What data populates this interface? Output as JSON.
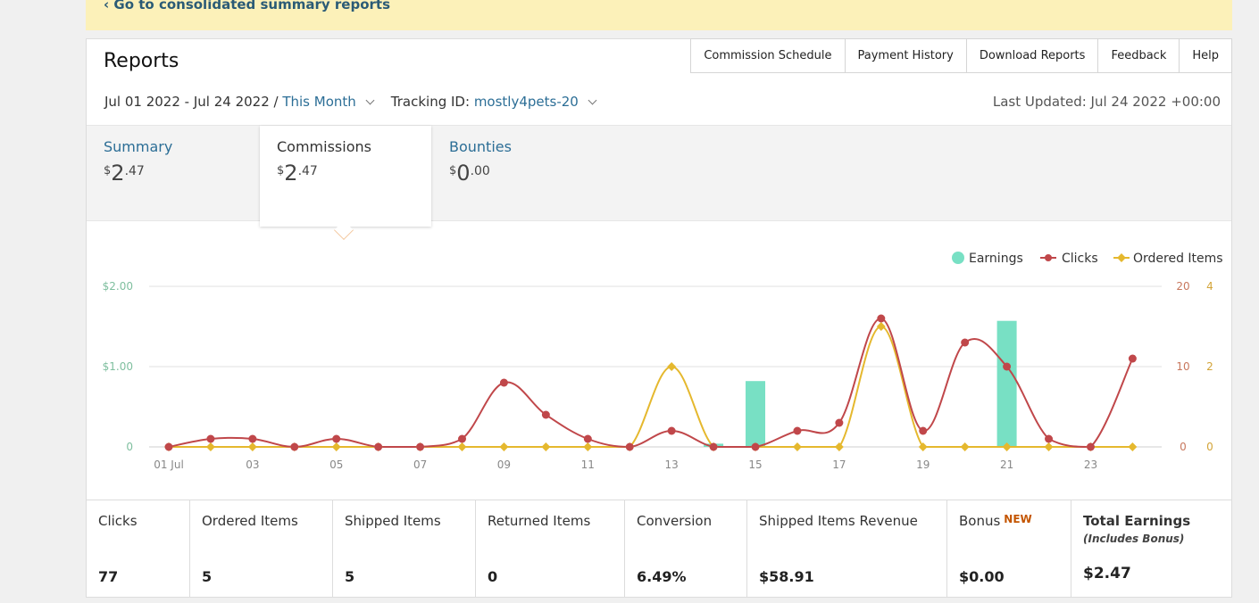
{
  "notice": {
    "link": "‹ Go to consolidated summary reports"
  },
  "header": {
    "title": "Reports"
  },
  "top_tabs": [
    "Commission Schedule",
    "Payment History",
    "Download Reports",
    "Feedback",
    "Help"
  ],
  "filters": {
    "date_range": "Jul 01 2022 - Jul 24 2022 /",
    "period": "This Month",
    "tracking_label": "Tracking ID:",
    "tracking_id": "mostly4pets-20",
    "last_updated": "Last Updated: Jul 24 2022 +00:00"
  },
  "metric_tabs": [
    {
      "label": "Summary",
      "currency": "$",
      "whole": "2",
      "cents": ".47",
      "active": false
    },
    {
      "label": "Commissions",
      "currency": "$",
      "whole": "2",
      "cents": ".47",
      "active": true
    },
    {
      "label": "Bounties",
      "currency": "$",
      "whole": "0",
      "cents": ".00",
      "active": false
    }
  ],
  "chart_data": {
    "type": "bar+line",
    "x": [
      "01 Jul",
      "02",
      "03",
      "04",
      "05",
      "06",
      "07",
      "08",
      "09",
      "10",
      "11",
      "12",
      "13",
      "14",
      "15",
      "16",
      "17",
      "18",
      "19",
      "20",
      "21",
      "22",
      "23",
      "24"
    ],
    "x_tick_labels": [
      "01 Jul",
      "03",
      "05",
      "07",
      "09",
      "11",
      "13",
      "15",
      "17",
      "19",
      "21",
      "23"
    ],
    "series": [
      {
        "name": "Earnings",
        "type": "bar",
        "axis": "left",
        "color": "#78e0c4",
        "values": [
          0,
          0,
          0,
          0,
          0,
          0,
          0,
          0,
          0,
          0,
          0,
          0,
          0,
          0.04,
          0.82,
          0,
          0,
          0,
          0,
          0,
          1.57,
          0,
          0,
          0
        ]
      },
      {
        "name": "Clicks",
        "type": "line",
        "axis": "right1",
        "color": "#c0474a",
        "values": [
          0,
          1,
          1,
          0,
          1,
          0,
          0,
          1,
          8,
          4,
          1,
          0,
          2,
          0,
          0,
          2,
          3,
          16,
          2,
          13,
          10,
          1,
          0,
          11
        ]
      },
      {
        "name": "Ordered Items",
        "type": "line",
        "axis": "right2",
        "color": "#e5b82e",
        "values": [
          0,
          0,
          0,
          0,
          0,
          0,
          0,
          0,
          0,
          0,
          0,
          0,
          2,
          0,
          0,
          0,
          0,
          3,
          0,
          0,
          0,
          0,
          0,
          0
        ]
      }
    ],
    "left_axis": {
      "ticks": [
        "0",
        "$1.00",
        "$2.00"
      ],
      "range": [
        0,
        2
      ]
    },
    "right_axis_1": {
      "ticks": [
        "0",
        "10",
        "20"
      ],
      "range": [
        0,
        20
      ]
    },
    "right_axis_2": {
      "ticks": [
        "0",
        "2",
        "4"
      ],
      "range": [
        0,
        4
      ]
    },
    "legend_position": "top-right",
    "grid": true
  },
  "stats": [
    {
      "label": "Clicks",
      "value": "77"
    },
    {
      "label": "Ordered Items",
      "value": "5"
    },
    {
      "label": "Shipped Items",
      "value": "5"
    },
    {
      "label": "Returned Items",
      "value": "0"
    },
    {
      "label": "Conversion",
      "value": "6.49%"
    },
    {
      "label": "Shipped Items Revenue",
      "value": "$58.91"
    },
    {
      "label": "Bonus",
      "badge": "NEW",
      "value": "$0.00"
    },
    {
      "label": "Total Earnings",
      "note": "(Includes Bonus)",
      "value": "$2.47"
    }
  ]
}
